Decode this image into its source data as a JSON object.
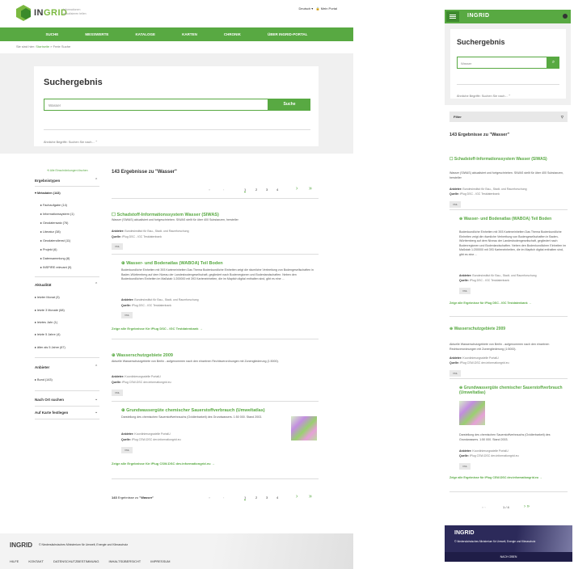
{
  "desktop": {
    "brand_prefix": "IN",
    "brand_suffix": "GRID",
    "tagline": "Informationen visualisieren teilen",
    "lang": "Deutsch",
    "portal_link": "Mein Portal",
    "nav": [
      "SUCHE",
      "MESSWERTE",
      "KATALOGE",
      "KARTEN",
      "CHRONIK",
      "ÜBER INGRID-PORTAL"
    ],
    "breadcrumb_prefix": "Sie sind hier:",
    "breadcrumb_home": "Startseite",
    "breadcrumb_current": "Freie Suche",
    "title": "Suchergebnis",
    "search_value": "Wasser",
    "search_button": "Suche",
    "similar": "Ähnliche Begriffe: Suchen Sie nach...",
    "reset_filters": "Alle Einschränkungen löschen",
    "facets": {
      "types_title": "Ergebnistypen",
      "metadata": "Metadaten (143)",
      "types": [
        "Fachaufgabe (14)",
        "Informationssystem (1)",
        "Geodatensatz (76)",
        "Literatur (38)",
        "Geodatendienst (11)",
        "Projekt (6)",
        "Datensammlung (8)",
        "INSPIRE relevant (9)"
      ],
      "timeliness_title": "Aktualität",
      "timeliness": [
        "letzter Monat (3)",
        "letzte 3 Monate (68)",
        "letztes Jahr (1)",
        "letzte 5 Jahre (4)",
        "älter als 5 Jahre (67)"
      ],
      "provider_title": "Anbieter",
      "provider": [
        "Bund (143)"
      ],
      "location_title": "Nach Ort suchen",
      "map_title": "Auf Karte festlegen"
    },
    "results_count": "143",
    "results_label": "Ergebnisse zu",
    "query": "\"Wasser\"",
    "pages": [
      "1",
      "2",
      "3",
      "4"
    ],
    "results": [
      {
        "title": "Schadstoff-Informationssystem Wasser (SIWAS)",
        "desc": "Wasser (SIWAS) aktualisiert und fortgeschrieben. SIWAS stellt für über 400 Substanzen, hersteller",
        "provider": "Bundesinstitut für Bau-, Stadt- und Raumforschung",
        "source": "iPlug DSC - IGC Testdatenbank",
        "tag": "XML"
      },
      {
        "title": "Wasser- und Bodenatlas (WABOA) Teil Boden",
        "desc": "Bodenkundliche Einheiten mit 393 Karteneinheiten Das Thema Bodenkundliche Einheiten zeigt die räumliche Verbreitung von Bodengesellschaften in Baden-Württemberg auf dem Niveau der Landesbodengesellschaft, gegliedert nach Bodenregionen und Bodenlandschaften. Neben den Bodenkundlichen Einheiten im Maßstab 1:200000 mit 393 Karteneinheiten, die im Mapitch digital enthalten sind, gibt es eine ...",
        "provider": "Bundesinstitut für Bau-, Stadt- und Raumforschung",
        "source": "iPlug DSC - IGC Testdatenbank",
        "tag": "XML"
      },
      {
        "title": "Wasserschutzgebiete 2009",
        "desc": "Aktuelle Wasserschutzgebiete von Berlin - aufgenommen nach den einzelnen Rechtsverordnungen mit Zonengliederung (1:5000).",
        "provider": "Koordinierungsstelle PortalU",
        "source": "iPlug CSW-DSC dev.informationgrid.eu",
        "tag": "XML"
      },
      {
        "title": "Grundwassergüte chemischer Sauerstoffverbrauch (Umweltatlas)",
        "desc": "Darstellung des chemischen Sauerstoffverbrauchs (Oxidierbarkeit) des Grundwassers. 1:50 000. Stand 2003.",
        "provider": "Koordinierungsstelle PortalU",
        "source": "iPlug CSW-DSC dev.informationgrid.eu",
        "tag": "XML"
      }
    ],
    "labels": {
      "provider": "Anbieter:",
      "source": "Quelle:"
    },
    "show_all_1": "Zeige alle Ergebnisse für iPlug DSC - IGC Testdatenbank",
    "show_all_2": "Zeige alle Ergebnisse für iPlug CSW-DSC dev.informationgrid.eu",
    "footer_brand": "INGRID",
    "footer_ministry": "© Niedersächsisches Ministerium für Umwelt, Energie und Klimaschutz",
    "footer_links": [
      "HILFE",
      "KONTAKT",
      "DATENSCHUTZBESTIMMUNG",
      "INHALTSÜBERSICHT",
      "IMPRESSUM"
    ]
  },
  "mobile": {
    "brand": "INGRID",
    "title": "Suchergebnis",
    "search_value": "Wasser",
    "similar": "Ähnliche Begriffe: Suchen Sie nach...",
    "filter": "Filter",
    "count_line": "143 Ergebnisse zu \"Wasser\"",
    "page_display": "1 / 4",
    "footer_brand": "INGRID",
    "footer_ministry": "© Niedersächsisches Ministerium für Umwelt, Energie und Klimaschutz",
    "footer_button": "NACH OBEN"
  },
  "colors": {
    "accent": "#58a942",
    "footer_mobile": "#2c2a5a"
  }
}
